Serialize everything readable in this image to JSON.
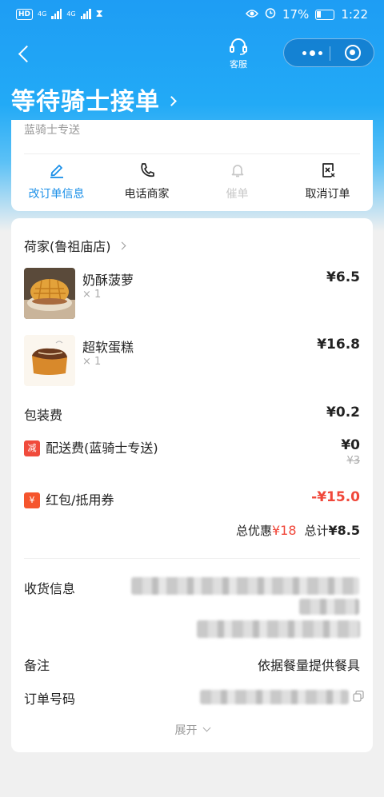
{
  "status_bar": {
    "battery": "17%",
    "time": "1:22",
    "hd": "HD",
    "sig1": "4G",
    "sig2": "4G"
  },
  "nav": {
    "service_label": "客服"
  },
  "order_status": {
    "title": "等待骑士接单"
  },
  "delivery": {
    "rider_type": "蓝骑士专送"
  },
  "actions": [
    {
      "label": "改订单信息",
      "icon": "edit-icon",
      "state": "active"
    },
    {
      "label": "电话商家",
      "icon": "phone-icon",
      "state": "normal"
    },
    {
      "label": "催单",
      "icon": "bell-icon",
      "state": "disabled"
    },
    {
      "label": "取消订单",
      "icon": "cancel-order-icon",
      "state": "normal"
    }
  ],
  "shop": {
    "name": "荷家(鲁祖庙店)"
  },
  "items": [
    {
      "name": "奶酥菠萝",
      "qty": "× 1",
      "price": "¥6.5"
    },
    {
      "name": "超软蛋糕",
      "qty": "× 1",
      "price": "¥16.8"
    }
  ],
  "fees": {
    "packaging_label": "包装费",
    "packaging_value": "¥0.2",
    "delivery_tag": "减",
    "delivery_label": "配送费(蓝骑士专送)",
    "delivery_value": "¥0",
    "delivery_original": "¥3",
    "coupon_tag": "¥",
    "coupon_label": "红包/抵用券",
    "coupon_value": "-¥15.0"
  },
  "totals": {
    "discount_label": "总优惠",
    "discount_value": "¥18",
    "total_label": "总计",
    "total_value": "¥8.5"
  },
  "info": {
    "address_label": "收货信息",
    "remark_label": "备注",
    "remark_value": "依据餐量提供餐具",
    "order_no_label": "订单号码"
  },
  "expand_label": "展开",
  "colors": {
    "brand_blue": "#1e9df4",
    "accent_red": "#f0473a",
    "link_blue": "#1a8fe8"
  }
}
